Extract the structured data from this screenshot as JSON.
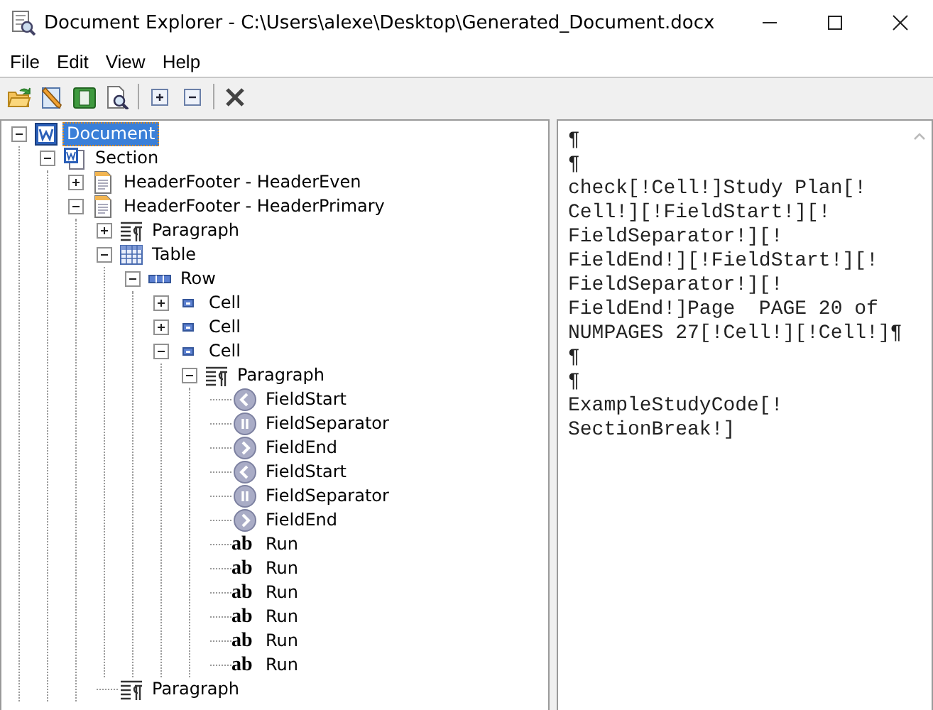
{
  "window": {
    "title": "Document Explorer - C:\\Users\\alexe\\Desktop\\Generated_Document.docx"
  },
  "menu": [
    "File",
    "Edit",
    "View",
    "Help"
  ],
  "toolbar": [
    {
      "kind": "open"
    },
    {
      "kind": "edit"
    },
    {
      "kind": "book"
    },
    {
      "kind": "preview"
    },
    {
      "kind": "sep"
    },
    {
      "kind": "expand"
    },
    {
      "kind": "collapse"
    },
    {
      "kind": "sep"
    },
    {
      "kind": "delete"
    }
  ],
  "tree": [
    {
      "label": "Document",
      "kind": "document",
      "expanded": true,
      "selected": true,
      "children": [
        {
          "label": "Section",
          "kind": "section",
          "expanded": true,
          "selected": false,
          "children": [
            {
              "label": "HeaderFooter - HeaderEven",
              "kind": "page",
              "expanded": false,
              "selected": false
            },
            {
              "label": "HeaderFooter - HeaderPrimary",
              "kind": "page",
              "expanded": true,
              "selected": false,
              "children": [
                {
                  "label": "Paragraph",
                  "kind": "paragraph",
                  "expanded": false,
                  "selected": false
                },
                {
                  "label": "Table",
                  "kind": "table",
                  "expanded": true,
                  "selected": false,
                  "children": [
                    {
                      "label": "Row",
                      "kind": "row",
                      "expanded": true,
                      "selected": false,
                      "children": [
                        {
                          "label": "Cell",
                          "kind": "cell",
                          "expanded": false,
                          "selected": false
                        },
                        {
                          "label": "Cell",
                          "kind": "cell",
                          "expanded": false,
                          "selected": false
                        },
                        {
                          "label": "Cell",
                          "kind": "cell",
                          "expanded": true,
                          "selected": false,
                          "children": [
                            {
                              "label": "Paragraph",
                              "kind": "paragraph",
                              "expanded": true,
                              "selected": false,
                              "children": [
                                {
                                  "label": "FieldStart",
                                  "kind": "field_start",
                                  "selected": false
                                },
                                {
                                  "label": "FieldSeparator",
                                  "kind": "field_separator",
                                  "selected": false
                                },
                                {
                                  "label": "FieldEnd",
                                  "kind": "field_end",
                                  "selected": false
                                },
                                {
                                  "label": "FieldStart",
                                  "kind": "field_start",
                                  "selected": false
                                },
                                {
                                  "label": "FieldSeparator",
                                  "kind": "field_separator",
                                  "selected": false
                                },
                                {
                                  "label": "FieldEnd",
                                  "kind": "field_end",
                                  "selected": false
                                },
                                {
                                  "label": "Run",
                                  "kind": "run",
                                  "icon_text": "ab",
                                  "selected": false
                                },
                                {
                                  "label": "Run",
                                  "kind": "run",
                                  "icon_text": "ab",
                                  "selected": false
                                },
                                {
                                  "label": "Run",
                                  "kind": "run",
                                  "icon_text": "ab",
                                  "selected": false
                                },
                                {
                                  "label": "Run",
                                  "kind": "run",
                                  "icon_text": "ab",
                                  "selected": false
                                },
                                {
                                  "label": "Run",
                                  "kind": "run",
                                  "icon_text": "ab",
                                  "selected": false
                                },
                                {
                                  "label": "Run",
                                  "kind": "run",
                                  "icon_text": "ab",
                                  "selected": false
                                }
                              ]
                            }
                          ]
                        }
                      ]
                    }
                  ]
                },
                {
                  "label": "Paragraph",
                  "kind": "paragraph",
                  "selected": false
                }
              ]
            }
          ]
        }
      ]
    }
  ],
  "text_view": {
    "lines": [
      "¶",
      "¶",
      "check[!Cell!]Study Plan[!",
      "Cell!][!FieldStart!][!",
      "FieldSeparator!][!",
      "FieldEnd!][!FieldStart!][!",
      "FieldSeparator!][!",
      "FieldEnd!]Page  PAGE 20 of",
      "NUMPAGES 27[!Cell!][!Cell!]¶",
      "¶",
      "¶",
      "ExampleStudyCode[!",
      "SectionBreak!]"
    ]
  }
}
